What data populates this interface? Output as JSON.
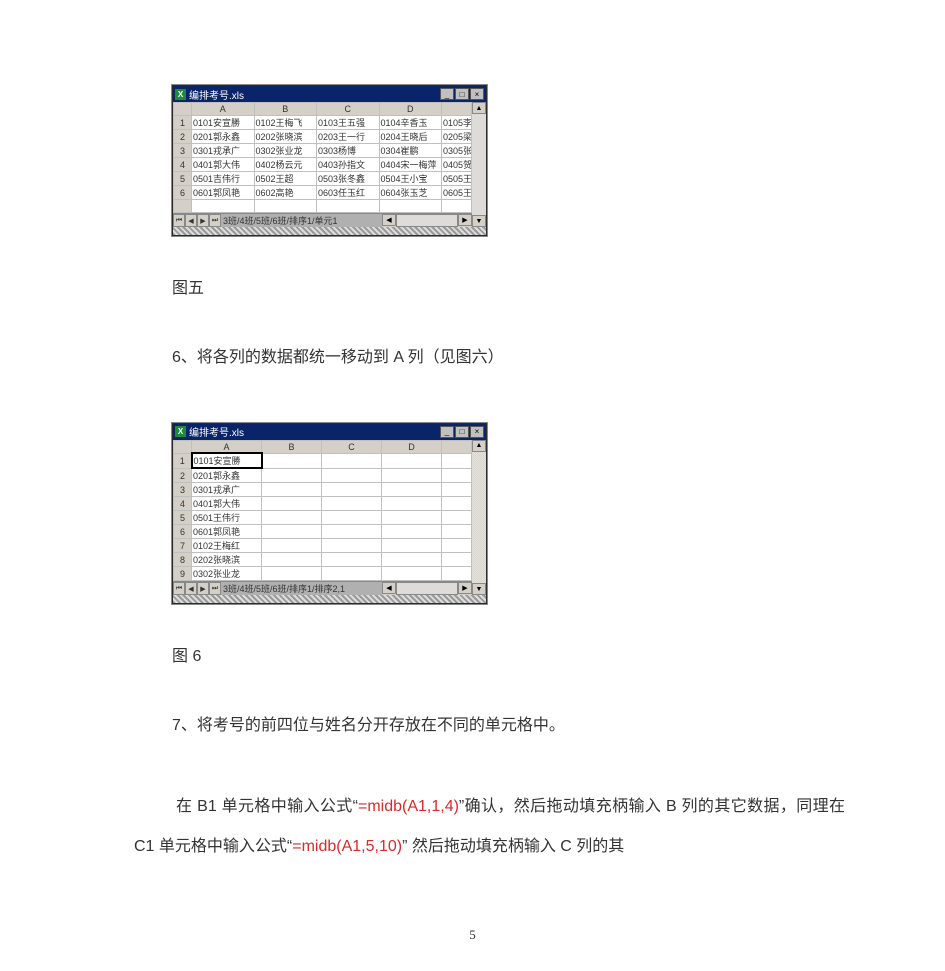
{
  "figure5": {
    "window_title": "编排考号.xls",
    "columns": [
      "A",
      "B",
      "C",
      "D",
      ""
    ],
    "rows": [
      [
        "1",
        "0101安宣勝",
        "0102王梅飞",
        "0103王五强",
        "0104辛香玉",
        "0105李"
      ],
      [
        "2",
        "0201郭永鑫",
        "0202张晓滨",
        "0203王一行",
        "0204王晓后",
        "0205梁"
      ],
      [
        "3",
        "0301戎承广",
        "0302张业龙",
        "0303杨博",
        "0304崔鹏",
        "0305张"
      ],
      [
        "4",
        "0401郭大伟",
        "0402杨云元",
        "0403孙指文",
        "0404宋一梅萍",
        "0405贺"
      ],
      [
        "5",
        "0501吉伟行",
        "0502王超",
        "0503张冬鑫",
        "0504王小宝",
        "0505王"
      ],
      [
        "6",
        "0601郭凤艳",
        "0602高艳",
        "0603任玉红",
        "0604张玉芝",
        "0605王"
      ]
    ],
    "tabstrip": "3班/4班/5班/6班/排序1/单元1",
    "caption_label": "图五"
  },
  "step6": "6、将各列的数据都统一移动到 A 列（见图六）",
  "figure6": {
    "window_title": "编排考号.xls",
    "columns": [
      "A",
      "B",
      "C",
      "D",
      ""
    ],
    "rows": [
      [
        "1",
        "0101安宣勝",
        "",
        "",
        "",
        ""
      ],
      [
        "2",
        "0201郭永鑫",
        "",
        "",
        "",
        ""
      ],
      [
        "3",
        "0301戎承广",
        "",
        "",
        "",
        ""
      ],
      [
        "4",
        "0401郭大伟",
        "",
        "",
        "",
        ""
      ],
      [
        "5",
        "0501王伟行",
        "",
        "",
        "",
        ""
      ],
      [
        "6",
        "0601郭凤艳",
        "",
        "",
        "",
        ""
      ],
      [
        "7",
        "0102王梅红",
        "",
        "",
        "",
        ""
      ],
      [
        "8",
        "0202张晓滨",
        "",
        "",
        "",
        ""
      ],
      [
        "9",
        "0302张业龙",
        "",
        "",
        "",
        ""
      ]
    ],
    "tabstrip": "3班/4班/5班/6班/排序1/排序2,1",
    "caption_label": "图 6"
  },
  "step7": "7、将考号的前四位与姓名分开存放在不同的单元格中。",
  "body": {
    "t1": "在 B1 单元格中输入公式“",
    "f1": "=midb(A1,1,4)",
    "t2": "”确认，然后拖动填充柄输入 B 列的其它数据，同理在 C1 单元格中输入公式“",
    "f2": "=midb(A1,5,10)",
    "t3": "”  然后拖动填充柄输入 C 列的其"
  },
  "page_number": "5"
}
